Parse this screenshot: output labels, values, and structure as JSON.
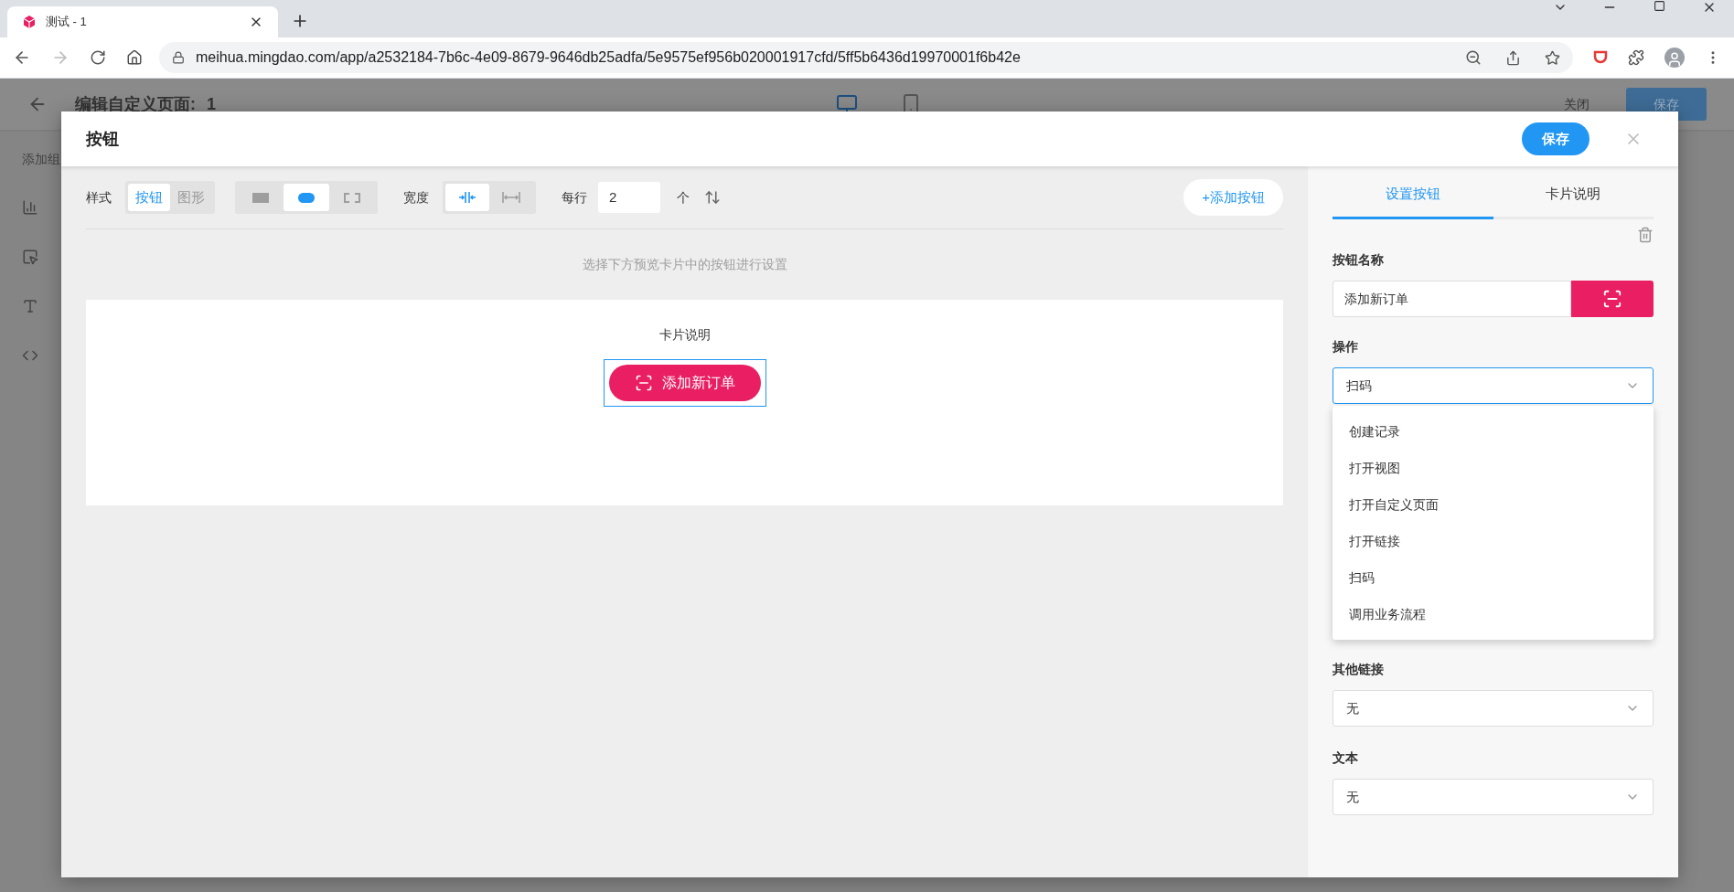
{
  "browser": {
    "tab_title": "测试 - 1",
    "url": "meihua.mingdao.com/app/a2532184-7b6c-4e09-8679-9646db25adfa/5e9575ef956b020001917cfd/5ff5b6436d19970001f6b42e"
  },
  "page": {
    "title": "编辑自定义页面:",
    "page_name": "1",
    "views": [
      {
        "kind": "desktop",
        "selected": true
      },
      {
        "kind": "mobile",
        "selected": false
      }
    ],
    "close": "关闭",
    "save": "保存"
  },
  "sidebar": {
    "heading": "添加组",
    "items": [
      {
        "kind": "chart"
      },
      {
        "kind": "button"
      },
      {
        "kind": "text"
      },
      {
        "kind": "code"
      }
    ]
  },
  "modal": {
    "title": "按钮",
    "save": "保存",
    "toolbar": {
      "style_label": "样式",
      "style_options": [
        {
          "label": "按钮",
          "selected": true
        },
        {
          "label": "图形",
          "selected": false
        }
      ],
      "shape_options": [
        {
          "kind": "rect",
          "selected": false
        },
        {
          "kind": "pill",
          "selected": true
        },
        {
          "kind": "dashed",
          "selected": false
        }
      ],
      "width_label": "宽度",
      "width_options": [
        {
          "kind": "compact",
          "selected": true
        },
        {
          "kind": "full",
          "selected": false
        }
      ],
      "per_row_label": "每行",
      "per_row_value": "2",
      "per_row_unit": "个",
      "add_button": "+添加按钮"
    },
    "hint": "选择下方预览卡片中的按钮进行设置",
    "card": {
      "title": "卡片说明",
      "button": {
        "label": "添加新订单",
        "selected": true
      }
    },
    "panel": {
      "tabs": [
        {
          "label": "设置按钮",
          "selected": true
        },
        {
          "label": "卡片说明",
          "selected": false
        }
      ],
      "name_label": "按钮名称",
      "name_value": "添加新订单",
      "operation_label": "操作",
      "operation_value": "扫码",
      "operation_open": true,
      "options": [
        {
          "label": "创建记录"
        },
        {
          "label": "打开视图"
        },
        {
          "label": "打开自定义页面"
        },
        {
          "label": "打开链接"
        },
        {
          "label": "扫码"
        },
        {
          "label": "调用业务流程"
        }
      ],
      "other_link_label": "其他链接",
      "other_link_value": "无",
      "text_label": "文本",
      "text_value": "无"
    }
  }
}
